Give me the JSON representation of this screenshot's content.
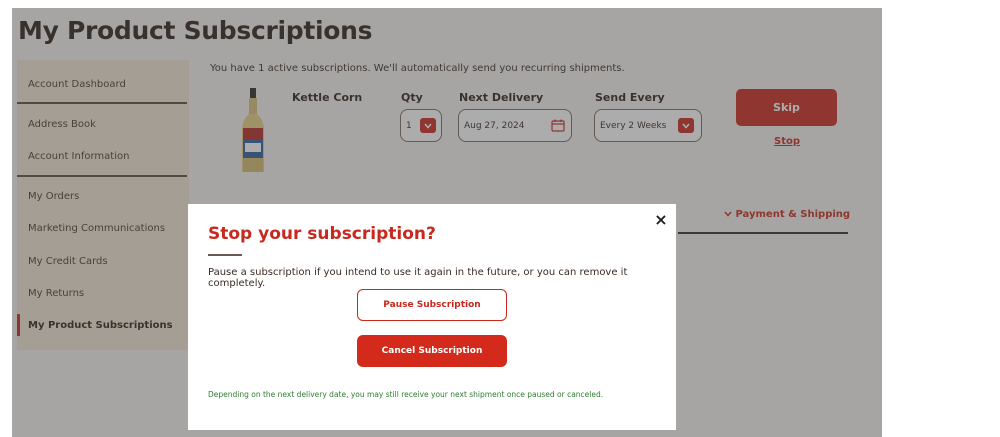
{
  "page": {
    "title": "My Product Subscriptions"
  },
  "sidebar": {
    "items": [
      {
        "label": "Account Dashboard"
      },
      {
        "label": "Address Book"
      },
      {
        "label": "Account Information"
      },
      {
        "label": "My Orders"
      },
      {
        "label": "Marketing Communications"
      },
      {
        "label": "My Credit Cards"
      },
      {
        "label": "My Returns"
      },
      {
        "label": "My Product Subscriptions",
        "active": true
      }
    ]
  },
  "subscriptions": {
    "intro": "You have 1 active subscriptions. We'll automatically send you recurring shipments.",
    "columns": {
      "qty": "Qty",
      "next_delivery": "Next Delivery",
      "send_every": "Send Every"
    },
    "item": {
      "name": "Kettle Corn",
      "qty": "1",
      "next_delivery": "Aug 27, 2024",
      "send_every": "Every 2 Weeks"
    },
    "skip_label": "Skip",
    "stop_label": "Stop",
    "payment_shipping": "Payment & Shipping"
  },
  "modal": {
    "close_glyph": "×",
    "title": "Stop your subscription?",
    "description": "Pause a subscription if you intend to use it again in the future, or you can remove it completely.",
    "pause_label": "Pause Subscription",
    "cancel_label": "Cancel Subscription",
    "note": "Depending on the next delivery date, you may still receive your next shipment once paused or canceled."
  },
  "colors": {
    "brand_red": "#c8281d",
    "sidebar_bg": "#f1e6d6",
    "note_green": "#2e7d32"
  },
  "icons": {
    "dropdown": "chevron-down-icon",
    "date": "calendar-icon",
    "close": "close-icon",
    "payment_toggle": "chevron-down-icon"
  }
}
